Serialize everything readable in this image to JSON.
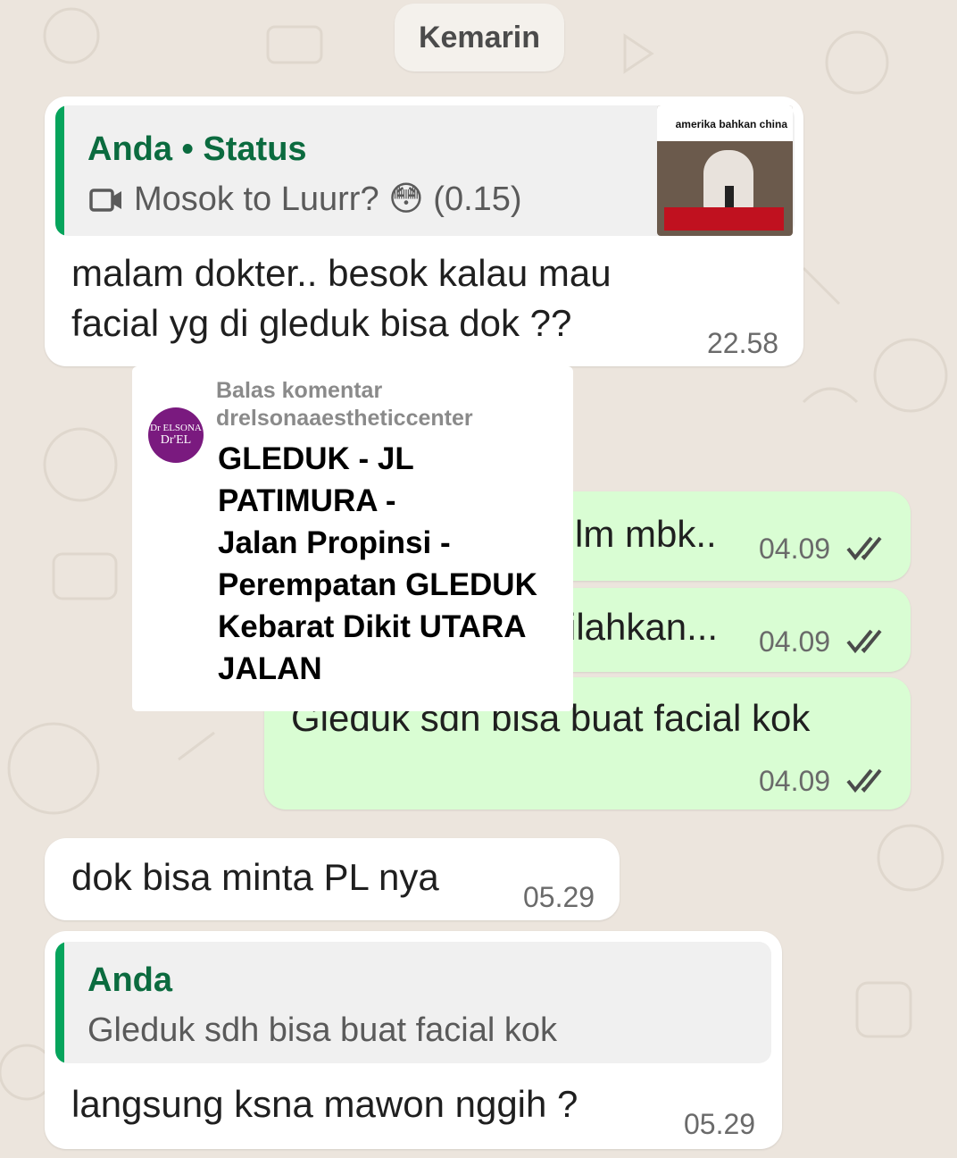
{
  "date_chip": "Kemarin",
  "messages": [
    {
      "direction": "incoming",
      "quote_author": "Anda • Status",
      "quote_text": "Mosok to Luurr? 😳 (0.15)",
      "thumbnail_caption": "amerika bahkan china",
      "text_line1": "malam dokter.. besok kalau mau",
      "text_line2": "facial yg di gleduk bisa dok ??",
      "time": "22.58"
    },
    {
      "direction": "outgoing",
      "text": "lm mbk..",
      "time": "04.09"
    },
    {
      "direction": "outgoing",
      "text": "ilahkan...",
      "time": "04.09"
    },
    {
      "direction": "outgoing",
      "text": "Gleduk sdh bisa buat facial kok",
      "time": "04.09"
    },
    {
      "direction": "incoming",
      "text": "dok bisa minta PL nya",
      "time": "05.29"
    },
    {
      "direction": "incoming",
      "quote_author": "Anda",
      "quote_text": "Gleduk sdh bisa buat facial kok",
      "text": "langsung ksna mawon nggih ?",
      "time": "05.29"
    }
  ],
  "overlay": {
    "reply_label": "Balas komentar",
    "username": "drelsonaaestheticcenter",
    "avatar_text1": "Dr ELSONA",
    "avatar_text2": "Dr'EL",
    "lines": [
      "GLEDUK - JL",
      "PATIMURA -",
      "Jalan Propinsi -",
      "Perempatan GLEDUK",
      "Kebarat Dikit UTARA",
      "JALAN"
    ]
  },
  "colors": {
    "background": "#ece5dd",
    "incoming_bubble": "#ffffff",
    "outgoing_bubble": "#d9fdd3",
    "quote_bar": "#06a45c",
    "avatar": "#7a1a7f"
  },
  "icons": {
    "video": "video-camera-icon",
    "read_receipt": "double-check-icon"
  }
}
